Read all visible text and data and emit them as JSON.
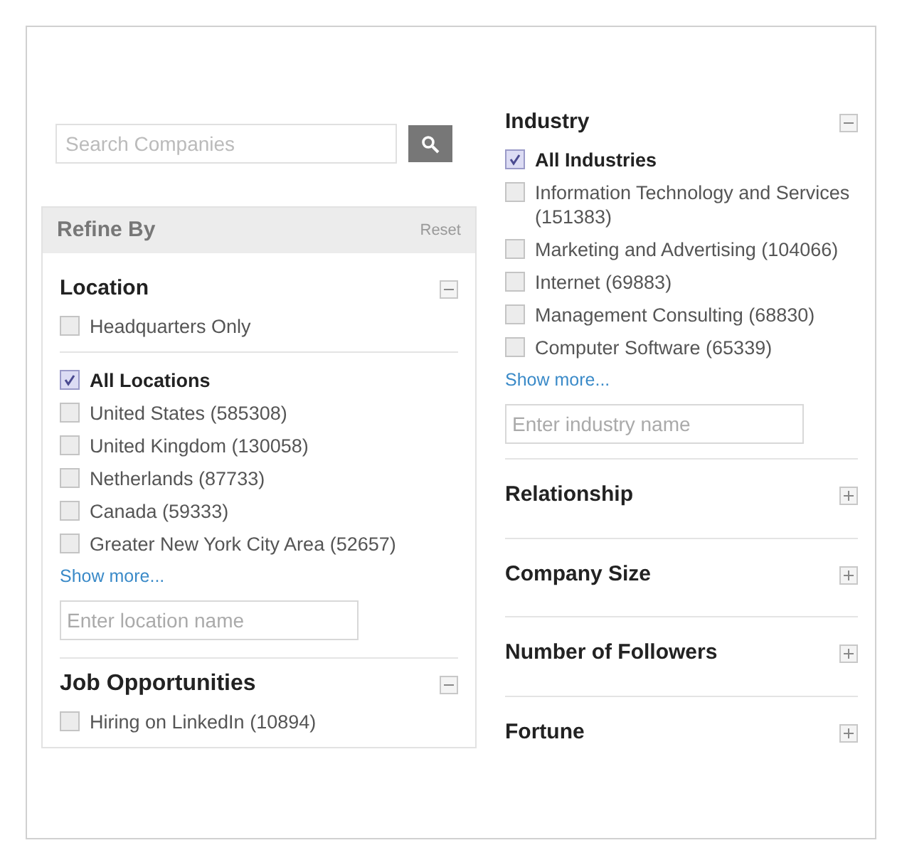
{
  "search": {
    "placeholder": "Search Companies"
  },
  "refine": {
    "title": "Refine By",
    "reset": "Reset"
  },
  "left_sections": [
    {
      "title": "Location",
      "expanded": true,
      "groups": [
        [
          {
            "label": "Headquarters Only",
            "checked": false
          }
        ],
        [
          {
            "label": "All Locations",
            "checked": true
          },
          {
            "label": "United States (585308)",
            "checked": false
          },
          {
            "label": "United Kingdom (130058)",
            "checked": false
          },
          {
            "label": "Netherlands (87733)",
            "checked": false
          },
          {
            "label": "Canada (59333)",
            "checked": false
          },
          {
            "label": "Greater New York City Area (52657)",
            "checked": false
          }
        ]
      ],
      "show_more": "Show more...",
      "placeholder": "Enter location name"
    },
    {
      "title": "Job Opportunities",
      "expanded": true,
      "groups": [
        [
          {
            "label": "Hiring on LinkedIn (10894)",
            "checked": false
          }
        ]
      ]
    }
  ],
  "right_sections": [
    {
      "title": "Industry",
      "expanded": true,
      "groups": [
        [
          {
            "label": "All Industries",
            "checked": true
          },
          {
            "label": "Information Technology and Services (151383)",
            "checked": false
          },
          {
            "label": "Marketing and Advertising (104066)",
            "checked": false
          },
          {
            "label": "Internet (69883)",
            "checked": false
          },
          {
            "label": "Management Consulting (68830)",
            "checked": false
          },
          {
            "label": "Computer Software (65339)",
            "checked": false
          }
        ]
      ],
      "show_more": "Show more...",
      "placeholder": "Enter industry name"
    },
    {
      "title": "Relationship",
      "expanded": false
    },
    {
      "title": "Company Size",
      "expanded": false
    },
    {
      "title": "Number of Followers",
      "expanded": false
    },
    {
      "title": "Fortune",
      "expanded": false
    }
  ]
}
